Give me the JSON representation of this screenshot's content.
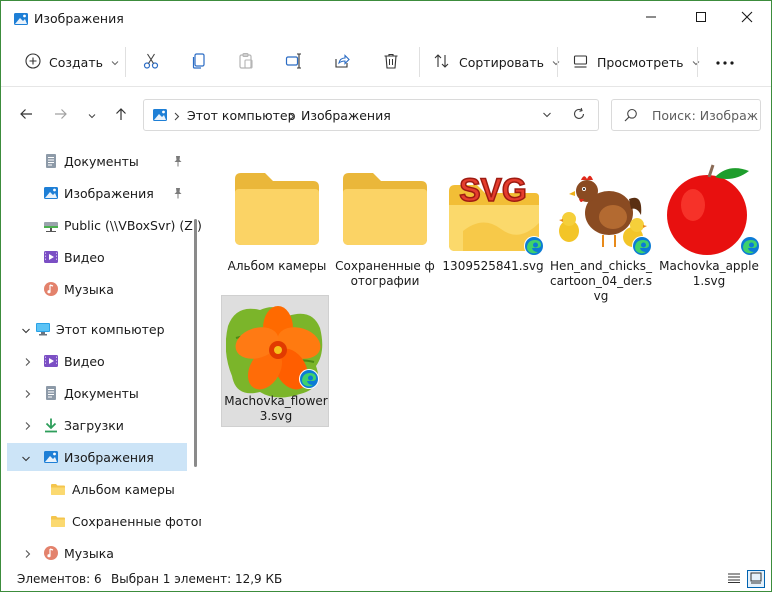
{
  "window": {
    "title": "Изображения",
    "accent": "#0067c0",
    "selection_bg": "#cce4f7"
  },
  "toolbar": {
    "create_label": "Создать",
    "sort_label": "Сортировать",
    "view_label": "Просмотреть",
    "icons": [
      "new-icon",
      "cut-icon",
      "copy-icon",
      "paste-icon",
      "rename-icon",
      "share-icon",
      "delete-icon",
      "sort-icon",
      "view-icon",
      "more-icon"
    ]
  },
  "address": {
    "crumbs": [
      "Этот компьютер",
      "Изображения"
    ],
    "search_placeholder": "Поиск: Изображе..."
  },
  "nav": {
    "items": [
      {
        "label": "Документы",
        "icon": "documents-icon",
        "pinned": true,
        "expandable": false,
        "selected": false
      },
      {
        "label": "Изображения",
        "icon": "pictures-icon",
        "pinned": true,
        "expandable": false,
        "selected": false
      },
      {
        "label": "Public (\\\\VBoxSvr) (Z:)",
        "icon": "network-drive-icon",
        "pinned": false,
        "expandable": false,
        "selected": false
      },
      {
        "label": "Видео",
        "icon": "videos-icon",
        "pinned": false,
        "expandable": false,
        "selected": false
      },
      {
        "label": "Музыка",
        "icon": "music-icon",
        "pinned": false,
        "expandable": false,
        "selected": false
      },
      {
        "label": "Этот компьютер",
        "icon": "computer-icon",
        "pinned": false,
        "expandable": true,
        "selected": false
      },
      {
        "label": "Видео",
        "icon": "videos-icon",
        "pinned": false,
        "expandable": true,
        "selected": false
      },
      {
        "label": "Документы",
        "icon": "documents-icon",
        "pinned": false,
        "expandable": true,
        "selected": false
      },
      {
        "label": "Загрузки",
        "icon": "downloads-icon",
        "pinned": false,
        "expandable": true,
        "selected": false
      },
      {
        "label": "Изображения",
        "icon": "pictures-icon",
        "pinned": false,
        "expandable": true,
        "selected": true
      },
      {
        "label": "Альбом камеры",
        "icon": "folder-icon",
        "pinned": false,
        "expandable": false,
        "selected": false
      },
      {
        "label": "Сохраненные фотогр",
        "icon": "folder-icon",
        "pinned": false,
        "expandable": false,
        "selected": false
      },
      {
        "label": "Музыка",
        "icon": "music-icon",
        "pinned": false,
        "expandable": true,
        "selected": false
      }
    ]
  },
  "files": [
    {
      "name": "Альбом камеры",
      "type": "folder",
      "selected": false
    },
    {
      "name": "Сохраненные фотографии",
      "type": "folder",
      "selected": false
    },
    {
      "name": "1309525841.svg",
      "type": "svg-file",
      "selected": false
    },
    {
      "name": "Hen_and_chicks_cartoon_04_der.svg",
      "type": "svg-file",
      "selected": false
    },
    {
      "name": "Machovka_apple1.svg",
      "type": "svg-file",
      "selected": false
    },
    {
      "name": "Machovka_flower3.svg",
      "type": "svg-file",
      "selected": true
    }
  ],
  "status": {
    "items_count": "Элементов: 6",
    "selected_info": "Выбран 1 элемент: 12,9 КБ"
  }
}
